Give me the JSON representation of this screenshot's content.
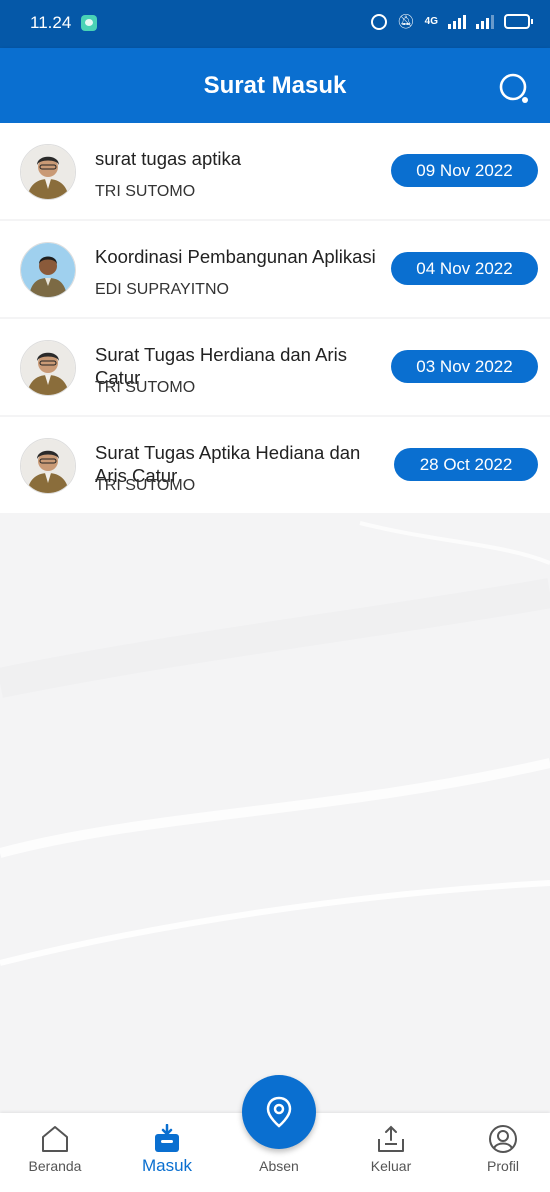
{
  "status_bar": {
    "time": "11.24",
    "network": "4G"
  },
  "app_bar": {
    "title": "Surat Masuk"
  },
  "letters": [
    {
      "title": "surat tugas aptika",
      "sender": "TRI SUTOMO",
      "date": "09 Nov 2022",
      "avatar": "avatar-photo"
    },
    {
      "title": "Koordinasi Pembangunan Aplikasi",
      "sender": "EDI SUPRAYITNO",
      "date": "04 Nov 2022",
      "avatar": "avatar-photo"
    },
    {
      "title": "Surat Tugas Herdiana dan Aris Catur",
      "sender": "TRI SUTOMO",
      "date": "03 Nov 2022",
      "avatar": "avatar-photo"
    },
    {
      "title": "Surat Tugas Aptika Hediana dan Aris Catur",
      "sender": "TRI SUTOMO",
      "date": "28 Oct 2022",
      "avatar": "avatar-photo"
    }
  ],
  "bottom_nav": {
    "items": [
      {
        "label": "Beranda",
        "icon": "home-icon",
        "active": false
      },
      {
        "label": "Masuk",
        "icon": "inbox-icon",
        "active": true
      },
      {
        "label": "Absen",
        "icon": "location-pin-icon",
        "active": false
      },
      {
        "label": "Keluar",
        "icon": "outbox-icon",
        "active": false
      },
      {
        "label": "Profil",
        "icon": "profile-icon",
        "active": false
      }
    ]
  },
  "colors": {
    "primary": "#0a6fd0",
    "status_bar": "#0558a8",
    "background": "#f4f4f5"
  }
}
